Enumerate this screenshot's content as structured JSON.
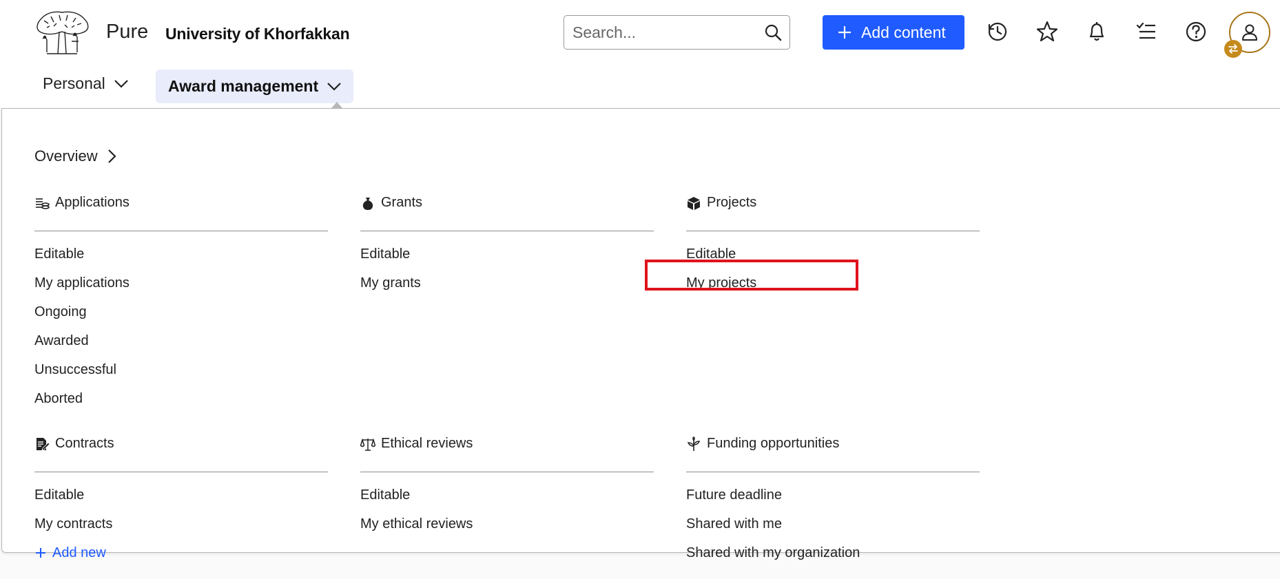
{
  "header": {
    "brand": "Pure",
    "organization": "University of Khorfakkan",
    "search_placeholder": "Search...",
    "add_content_label": "Add content"
  },
  "nav": {
    "personal_label": "Personal",
    "award_label": "Award management"
  },
  "menu": {
    "overview_label": "Overview",
    "applications": {
      "title": "Applications",
      "items": [
        "Editable",
        "My applications",
        "Ongoing",
        "Awarded",
        "Unsuccessful",
        "Aborted"
      ]
    },
    "grants": {
      "title": "Grants",
      "items": [
        "Editable",
        "My grants"
      ]
    },
    "projects": {
      "title": "Projects",
      "items": [
        "Editable",
        "My projects"
      ]
    },
    "contracts": {
      "title": "Contracts",
      "items": [
        "Editable",
        "My contracts"
      ],
      "add_new_label": "Add new"
    },
    "ethical_reviews": {
      "title": "Ethical reviews",
      "items": [
        "Editable",
        "My ethical reviews"
      ]
    },
    "funding_opportunities": {
      "title": "Funding opportunities",
      "items": [
        "Future deadline",
        "Shared with me",
        "Shared with my organization"
      ]
    }
  },
  "colors": {
    "accent": "#1f5bff",
    "nav_active_bg": "#e8ecfb",
    "highlight": "#e0131c",
    "avatar_ring": "#a8761a"
  },
  "icons": {
    "search": "search-icon",
    "add": "plus-icon",
    "recent": "history-icon",
    "favorites": "star-icon",
    "notifications": "bell-icon",
    "tasks": "checklist-icon",
    "help": "help-icon",
    "user": "user-icon",
    "switch": "switch-icon"
  }
}
